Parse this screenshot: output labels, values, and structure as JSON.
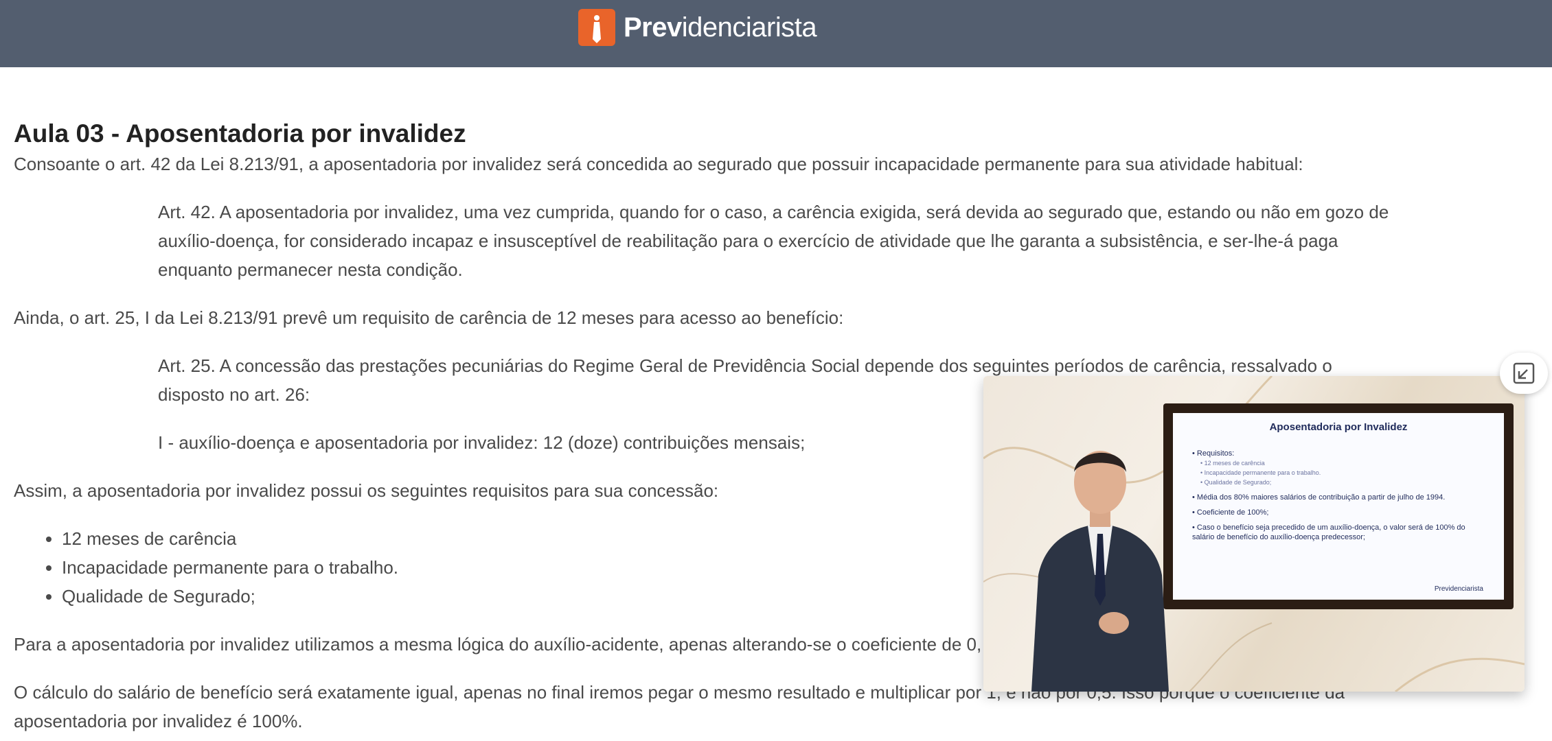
{
  "header": {
    "brand_prefix": "Prev",
    "brand_suffix": "idenciarista",
    "accent_color": "#e9642a",
    "bar_color": "#535e6f"
  },
  "article": {
    "title": "Aula 03 - Aposentadoria por invalidez",
    "p1": "Consoante o art. 42 da Lei 8.213/91, a aposentadoria por invalidez será concedida ao segurado que possuir incapacidade permanente para sua atividade habitual:",
    "quote1": "Art. 42. A aposentadoria por invalidez, uma vez cumprida, quando for o caso, a carência exigida, será devida ao segurado que, estando ou não em gozo de auxílio-doença, for considerado incapaz e insusceptível de reabilitação para o exercício de atividade que lhe garanta a subsistência, e ser-lhe-á paga enquanto permanecer nesta condição.",
    "p2": "Ainda, o art. 25, I da Lei 8.213/91 prevê um requisito de carência de 12 meses para acesso ao benefício:",
    "quote2": "Art. 25. A concessão das prestações pecuniárias do Regime Geral de Previdência Social depende dos seguintes períodos de carência, ressalvado o disposto no art. 26:",
    "quote3": "I - auxílio-doença e aposentadoria por invalidez: 12 (doze) contribuições mensais;",
    "p3": "Assim, a aposentadoria por invalidez possui os seguintes requisitos para sua concessão:",
    "requirements": [
      "12 meses de carência",
      "Incapacidade permanente para o trabalho.",
      "Qualidade de Segurado;"
    ],
    "p4": "Para a aposentadoria por invalidez utilizamos a mesma lógica do auxílio-acidente, apenas alterando-se o coeficiente de 0,",
    "p5": "O cálculo do salário de benefício será exatamente igual, apenas no final iremos pegar o mesmo resultado e multiplicar por 1, e não por 0,5. Isso porque o coeficiente da aposentadoria por invalidez é 100%."
  },
  "video": {
    "slide_title": "Aposentadoria por Invalidez",
    "slide_items": [
      "• Requisitos:",
      "• 12 meses de carência",
      "• Incapacidade permanente para o trabalho.",
      "• Qualidade de Segurado;",
      "• Média dos 80% maiores salários de contribuição a partir de julho de 1994.",
      "• Coeficiente de 100%;",
      "• Caso o benefício seja precedido de um auxílio-doença, o valor será de 100% do salário de benefício do auxílio-doença predecessor;"
    ],
    "slide_brand": "Previdenciarista",
    "expand_icon": "expand-icon"
  }
}
